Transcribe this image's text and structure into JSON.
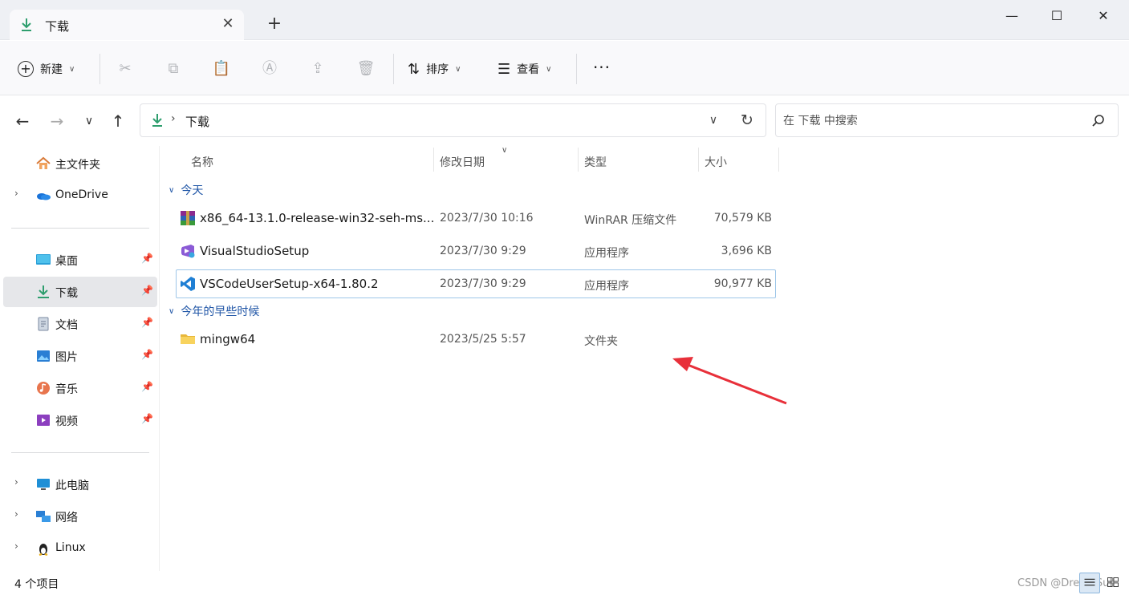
{
  "window": {
    "tab_title": "下载",
    "close_tab": "✕",
    "new_tab": "+",
    "minimize": "—",
    "maximize": "☐",
    "close": "✕"
  },
  "toolbar": {
    "new_label": "新建",
    "sort_label": "排序",
    "view_label": "查看",
    "more_label": "···"
  },
  "address": {
    "location": "下载",
    "search_placeholder": "在 下载 中搜索"
  },
  "sidebar": {
    "home": "主文件夹",
    "onedrive": "OneDrive",
    "quick": [
      {
        "label": "桌面",
        "icon": "desktop-icon"
      },
      {
        "label": "下载",
        "icon": "download-icon"
      },
      {
        "label": "文档",
        "icon": "document-icon"
      },
      {
        "label": "图片",
        "icon": "picture-icon"
      },
      {
        "label": "音乐",
        "icon": "music-icon"
      },
      {
        "label": "视频",
        "icon": "video-icon"
      }
    ],
    "thispc": "此电脑",
    "network": "网络",
    "linux": "Linux"
  },
  "columns": {
    "name": "名称",
    "date": "修改日期",
    "type": "类型",
    "size": "大小"
  },
  "groups": {
    "today": "今天",
    "earlier": "今年的早些时候"
  },
  "files": [
    {
      "name": "x86_64-13.1.0-release-win32-seh-ms...",
      "date": "2023/7/30 10:16",
      "type": "WinRAR 压缩文件",
      "size": "70,579 KB",
      "icon": "winrar-icon"
    },
    {
      "name": "VisualStudioSetup",
      "date": "2023/7/30 9:29",
      "type": "应用程序",
      "size": "3,696 KB",
      "icon": "visual-studio-icon"
    },
    {
      "name": "VSCodeUserSetup-x64-1.80.2",
      "date": "2023/7/30 9:29",
      "type": "应用程序",
      "size": "90,977 KB",
      "icon": "vscode-icon"
    },
    {
      "name": "mingw64",
      "date": "2023/5/25 5:57",
      "type": "文件夹",
      "size": "",
      "icon": "folder-icon"
    }
  ],
  "status": {
    "count": "4 个项目",
    "watermark": "CSDN @DreamSull"
  },
  "colors": {
    "accent_green": "#2e9e6e",
    "group_blue": "#1f55a6",
    "annotation_red": "#e8303a"
  }
}
